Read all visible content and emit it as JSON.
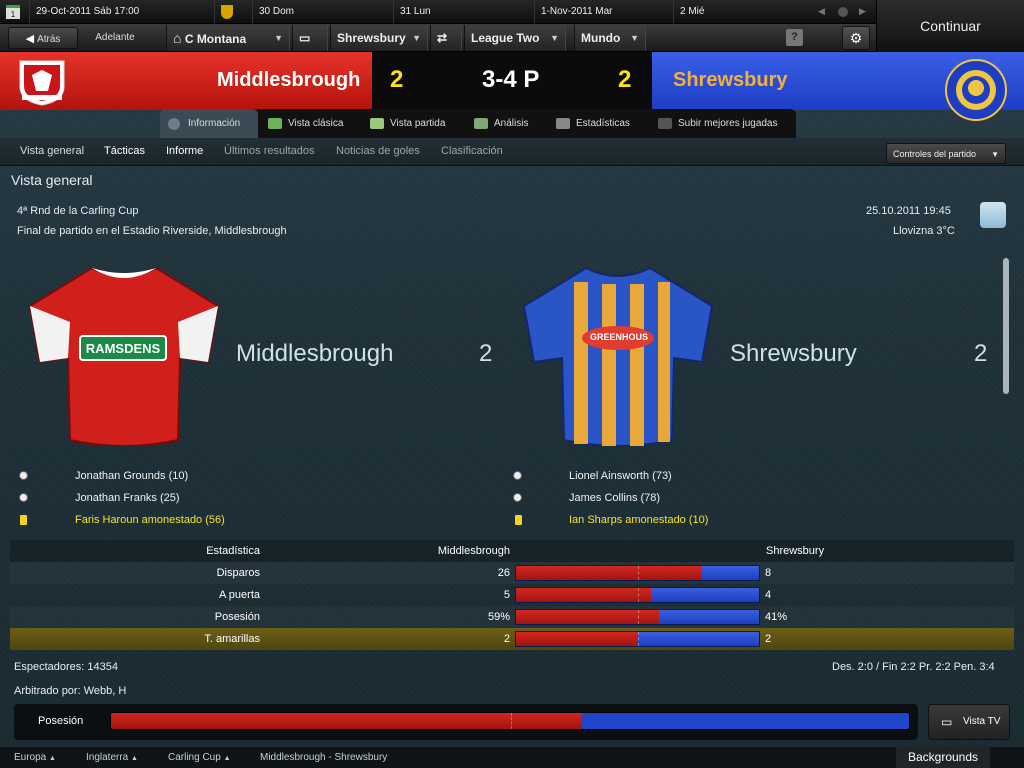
{
  "calendar": {
    "date": "29-Oct-2011 Sáb 17:00",
    "days": [
      "30  Dom",
      "31  Lun",
      "1-Nov-2011  Mar",
      "2  Mié"
    ]
  },
  "nav": {
    "back": "Atrás",
    "forward": "Adelante",
    "club": "C Montana",
    "team": "Shrewsbury",
    "competition": "League Two",
    "world": "Mundo",
    "help": "?",
    "continue": "Continuar"
  },
  "header": {
    "home": "Middlesbrough",
    "away": "Shrewsbury",
    "home_score": "2",
    "away_score": "2",
    "result": "3-4 P"
  },
  "tabs": [
    {
      "label": "Información"
    },
    {
      "label": "Vista clásica"
    },
    {
      "label": "Vista partida"
    },
    {
      "label": "Análisis"
    },
    {
      "label": "Estadísticas"
    },
    {
      "label": "Subir mejores jugadas"
    }
  ],
  "subnav": [
    {
      "label": "Vista general"
    },
    {
      "label": "Tácticas"
    },
    {
      "label": "Informe"
    },
    {
      "label": "Últimos resultados"
    },
    {
      "label": "Noticias de goles"
    },
    {
      "label": "Clasificación"
    }
  ],
  "match_controls": "Controles del partido",
  "section_title": "Vista general",
  "info": {
    "round": "4ª Rnd de la Carling Cup",
    "venue": "Final de partido en el Estadio Riverside, Middlesbrough",
    "datetime": "25.10.2011 19:45",
    "weather": "Llovizna 3°C"
  },
  "home": {
    "name": "Middlesbrough",
    "score": "2",
    "shirt_sponsor": "RAMSDENS",
    "events": [
      {
        "type": "goal",
        "text": "Jonathan Grounds (10)"
      },
      {
        "type": "goal",
        "text": "Jonathan Franks (25)"
      },
      {
        "type": "card",
        "text": "Faris Haroun amonestado (56)"
      }
    ]
  },
  "away": {
    "name": "Shrewsbury",
    "score": "2",
    "shirt_sponsor": "GREENHOUS",
    "events": [
      {
        "type": "goal",
        "text": "Lionel Ainsworth (73)"
      },
      {
        "type": "goal",
        "text": "James Collins (78)"
      },
      {
        "type": "card",
        "text": "Ian Sharps amonestado (10)"
      }
    ]
  },
  "stats": {
    "header": {
      "label": "Estadística",
      "home": "Middlesbrough",
      "away": "Shrewsbury"
    },
    "rows": [
      {
        "label": "Disparos",
        "home": "26",
        "away": "8",
        "home_v": 26,
        "away_v": 8
      },
      {
        "label": "A puerta",
        "home": "5",
        "away": "4",
        "home_v": 5,
        "away_v": 4
      },
      {
        "label": "Posesión",
        "home": "59%",
        "away": "41%",
        "home_v": 59,
        "away_v": 41
      },
      {
        "label": "T. amarillas",
        "home": "2",
        "away": "2",
        "home_v": 2,
        "away_v": 2
      }
    ]
  },
  "attendance": "Espectadores: 14354",
  "aggregate": "Des. 2:0 / Fin 2:2 Pr. 2:2 Pen. 3:4",
  "referee": "Arbitrado por: Webb, H",
  "possession": {
    "label": "Posesión",
    "home": 59,
    "away": 41
  },
  "vista_tv": "Vista TV",
  "breadcrumb": [
    "Europa",
    "Inglaterra",
    "Carling Cup",
    "Middlesbrough - Shrewsbury"
  ],
  "backgrounds": "Backgrounds",
  "colors": {
    "home": "#c8181a",
    "away": "#2346cf",
    "score": "#ffe21a",
    "card": "#f6d21b"
  }
}
